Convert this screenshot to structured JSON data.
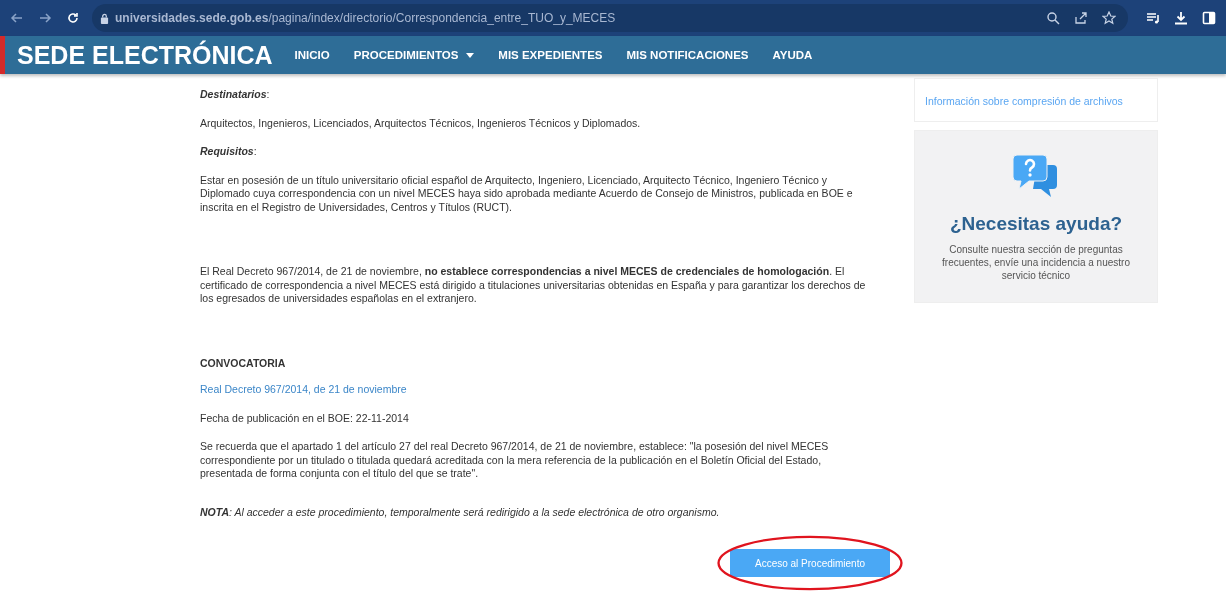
{
  "browser": {
    "url": "**universidades.sede.gob.es**/pagina/index/directorio/Correspondencia_entre_TUO_y_MECES"
  },
  "header": {
    "title": "SEDE ELECTRÓNICA",
    "nav": [
      {
        "label": "INICIO",
        "dropdown": false
      },
      {
        "label": "PROCEDIMIENTOS",
        "dropdown": true
      },
      {
        "label": "MIS EXPEDIENTES",
        "dropdown": false
      },
      {
        "label": "MIS NOTIFICACIONES",
        "dropdown": false
      },
      {
        "label": "AYUDA",
        "dropdown": false
      }
    ]
  },
  "content": [
    {
      "kind": "heading",
      "text": "Destinatarios",
      "suffix": ":"
    },
    {
      "kind": "paragraph",
      "text": "Arquitectos, Ingenieros, Licenciados, Arquitectos Técnicos, Ingenieros Técnicos y Diplomados."
    },
    {
      "kind": "heading",
      "text": "Requisitos",
      "suffix": ":"
    },
    {
      "kind": "paragraph",
      "text": "Estar en posesión de un título universitario oficial español de Arquitecto, Ingeniero, Licenciado, Arquitecto Técnico, Ingeniero Técnico y Diplomado cuya correspondencia con un nivel MECES haya sido aprobada mediante Acuerdo de Consejo de Ministros, publicada en BOE e inscrita en el Registro de Universidades, Centros y Títulos (RUCT)."
    },
    {
      "kind": "spacer"
    },
    {
      "kind": "paragraph",
      "text": "El Real Decreto 967/2014, de 21 de noviembre, **no establece correspondencias a nivel MECES de credenciales de homologación**. El certificado de correspondencia a nivel MECES está dirigido a titulaciones universitarias obtenidas en España y para garantizar los derechos de los egresados de universidades españolas en el extranjero."
    },
    {
      "kind": "spacer"
    },
    {
      "kind": "section",
      "text": "CONVOCATORIA"
    },
    {
      "kind": "link",
      "text": "Real Decreto 967/2014, de 21 de noviembre"
    },
    {
      "kind": "paragraph",
      "text": "Fecha de publicación en el BOE: 22-11-2014"
    },
    {
      "kind": "paragraph",
      "text": "Se recuerda que el apartado 1 del artículo 27 del real Decreto 967/2014, de 21 de noviembre, establece: \"la posesión del nivel MECES correspondiente por un titulado o titulada quedará acreditada con la mera referencia de la publicación en el Boletín Oficial del Estado, presentada de forma conjunta con el título del que se trate\"."
    },
    {
      "kind": "note",
      "text": "**NOTA**: Al acceder a este procedimiento, temporalmente será redirigido a la sede electrónica de otro organismo."
    }
  ],
  "access_button": {
    "label": "Acceso al Procedimiento",
    "highlighted": true
  },
  "sidebar": {
    "link": "Información sobre compresión de archivos",
    "help": {
      "title": "¿Necesitas ayuda?",
      "text": "Consulte nuestra sección de preguntas frecuentes, envíe una incidencia a nuestro servicio técnico"
    }
  }
}
